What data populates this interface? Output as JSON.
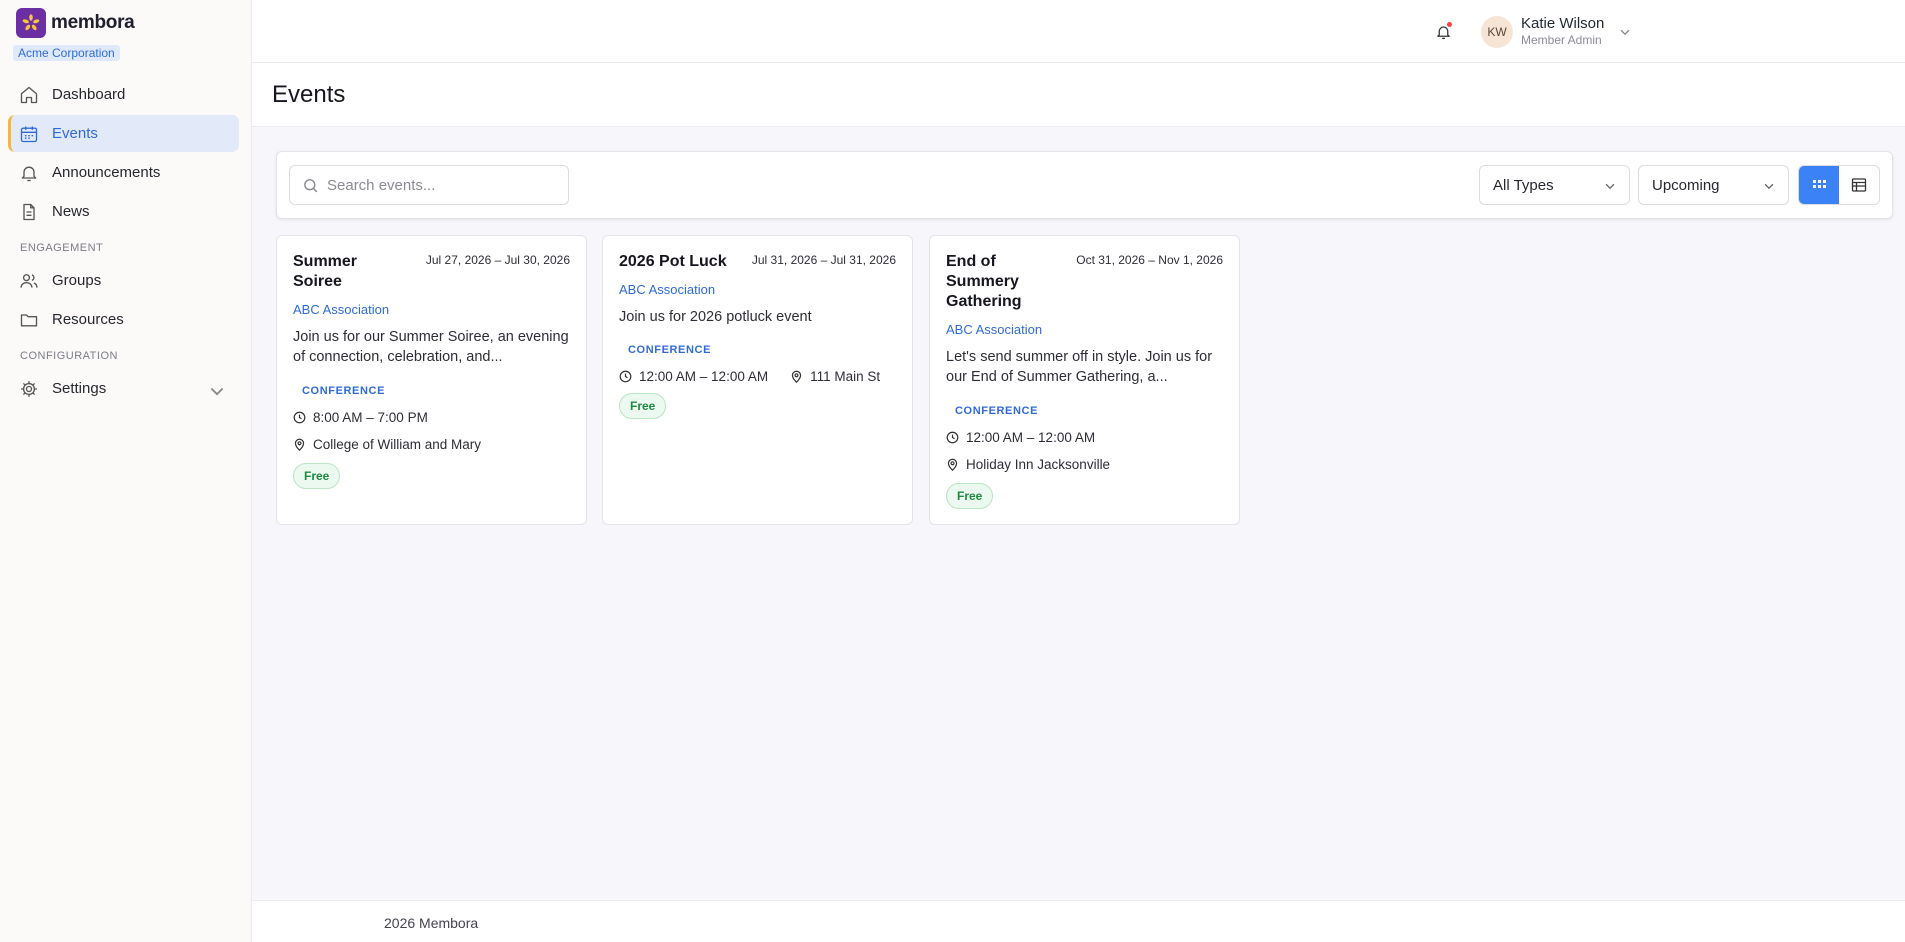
{
  "brand": {
    "name": "membora",
    "org": "Acme Corporation"
  },
  "sidebar": {
    "items": [
      {
        "label": "Dashboard"
      },
      {
        "label": "Events"
      },
      {
        "label": "Announcements"
      },
      {
        "label": "News"
      }
    ],
    "sections": [
      {
        "title": "ENGAGEMENT",
        "items": [
          {
            "label": "Groups"
          },
          {
            "label": "Resources"
          }
        ]
      },
      {
        "title": "CONFIGURATION",
        "items": [
          {
            "label": "Settings"
          }
        ]
      }
    ]
  },
  "user": {
    "initials": "KW",
    "name": "Katie Wilson",
    "role": "Member Admin"
  },
  "page": {
    "title": "Events"
  },
  "filters": {
    "search_placeholder": "Search events...",
    "type_value": "All Types",
    "time_value": "Upcoming"
  },
  "events": [
    {
      "title": "Summer Soiree",
      "dates": "Jul 27, 2026 – Jul 30, 2026",
      "org": "ABC Association",
      "description": "Join us for our Summer Soiree, an evening of connection, celebration, and...",
      "type": "CONFERENCE",
      "time": "8:00 AM – 7:00 PM",
      "location": "College of William and Mary",
      "price": "Free"
    },
    {
      "title": "2026 Pot Luck",
      "dates": "Jul 31, 2026 – Jul 31, 2026",
      "org": "ABC Association",
      "description": "Join us for 2026 potluck event",
      "type": "CONFERENCE",
      "time": "12:00 AM – 12:00 AM",
      "location": "111 Main St",
      "price": "Free"
    },
    {
      "title": "End of Summery Gathering",
      "dates": "Oct 31, 2026 – Nov 1, 2026",
      "org": "ABC Association",
      "description": "Let's send summer off in style. Join us for our End of Summer Gathering, a...",
      "type": "CONFERENCE",
      "time": "12:00 AM – 12:00 AM",
      "location": "Holiday Inn Jacksonville",
      "price": "Free"
    }
  ],
  "footer": {
    "text": "2026 Membora"
  },
  "colors": {
    "accent": "#3b82f6",
    "brand": "#6b2fa3",
    "active_marker": "#f1b742",
    "link": "#2f6bd8",
    "free_badge": "#1d8a3f"
  }
}
